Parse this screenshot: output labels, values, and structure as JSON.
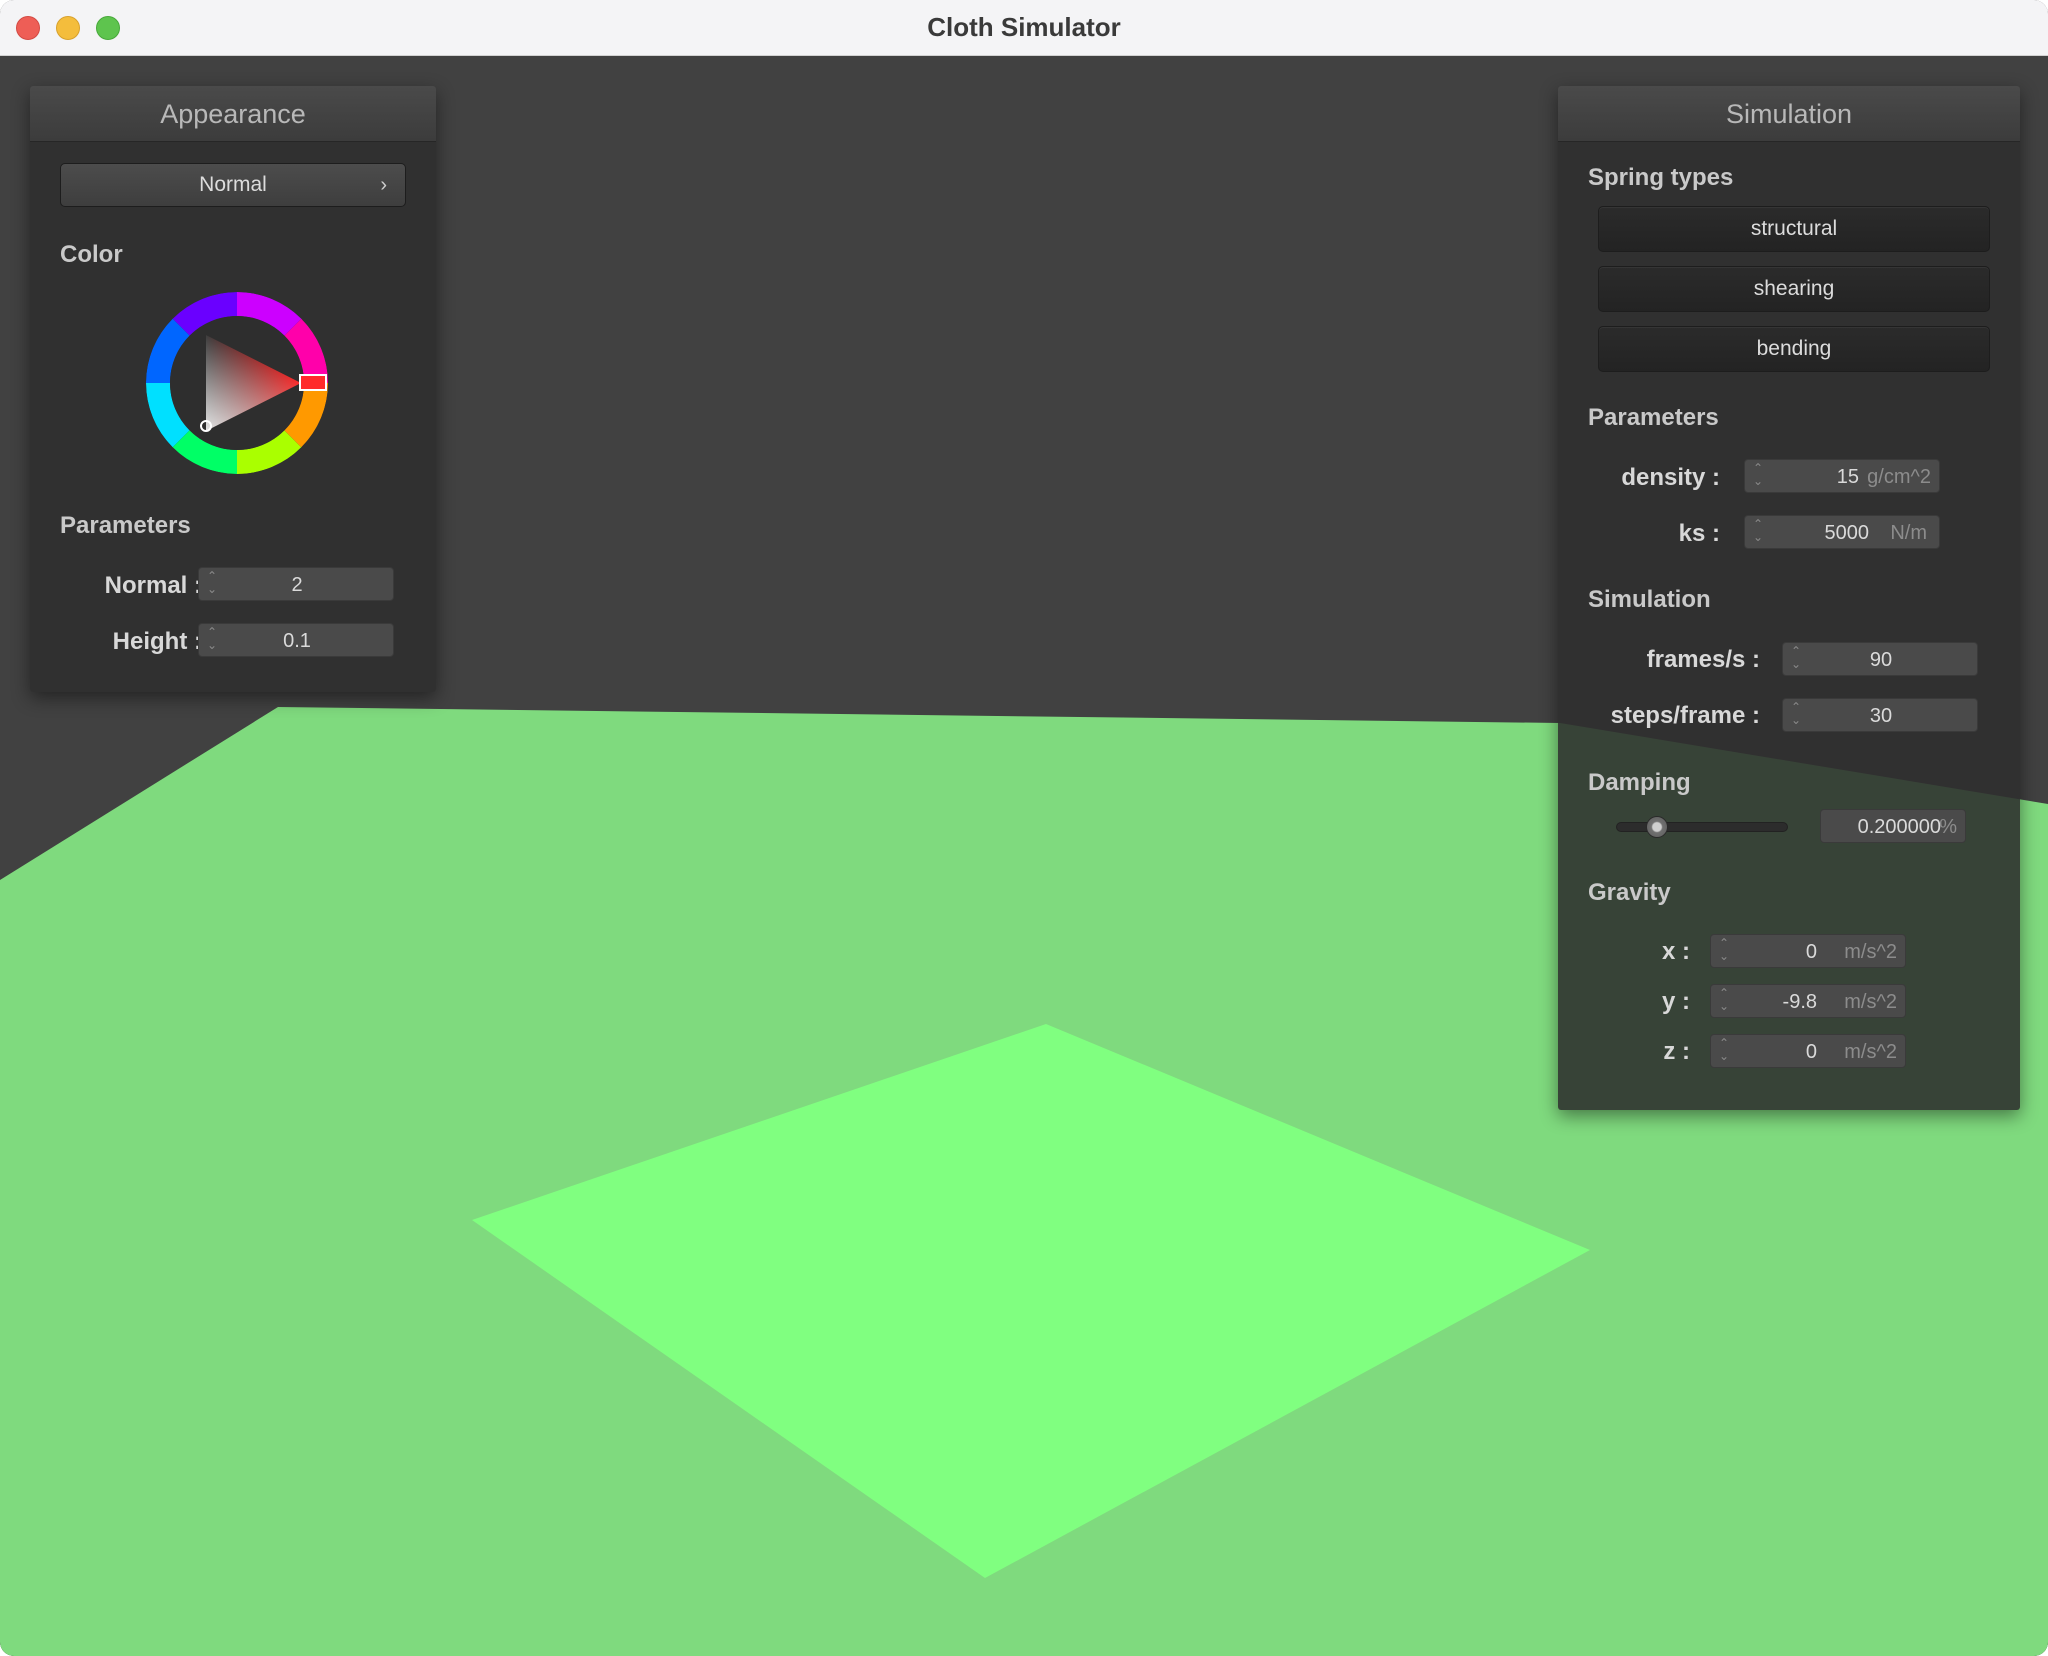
{
  "window": {
    "title": "Cloth Simulator"
  },
  "appearance": {
    "header": "Appearance",
    "shader_select": "Normal",
    "shader_chevron": "›",
    "color_section": "Color",
    "selected_color": "#ff0000",
    "params_section": "Parameters",
    "normal_label": "Normal :",
    "normal_value": "2",
    "height_label": "Height :",
    "height_value": "0.1"
  },
  "simulation": {
    "header": "Simulation",
    "spring_section": "Spring types",
    "spring_types": [
      "structural",
      "shearing",
      "bending"
    ],
    "params_section": "Parameters",
    "density_label": "density :",
    "density_value": "15",
    "density_unit": "g/cm^2",
    "ks_label": "ks :",
    "ks_value": "5000",
    "ks_unit": "N/m",
    "sim_section": "Simulation",
    "fps_label": "frames/s :",
    "fps_value": "90",
    "steps_label": "steps/frame :",
    "steps_value": "30",
    "damping_section": "Damping",
    "damping_value": "0.200000",
    "damping_unit": "%",
    "damping_slider_fraction": 0.2,
    "gravity_section": "Gravity",
    "gx_label": "x :",
    "gx_value": "0",
    "gy_label": "y :",
    "gy_value": "-9.8",
    "gz_label": "z :",
    "gz_value": "0",
    "gravity_unit": "m/s^2"
  },
  "scene": {
    "background_color": "#414141",
    "plane_color": "#7fda7e",
    "cloth_color": "#80ff80"
  }
}
